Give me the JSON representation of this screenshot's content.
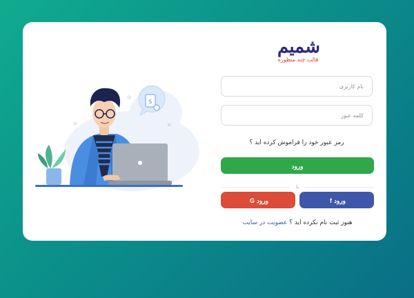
{
  "logo": {
    "mark": "شمیم",
    "tagline": "قالب چند منظوره"
  },
  "form": {
    "username_placeholder": "نام کاربری",
    "password_placeholder": "کلمه عبور",
    "forgot_text": "رمز عبور خود را فراموش کرده اید ؟",
    "login_label": "ورود",
    "or_text": "یا",
    "facebook_login_label": "ورود",
    "google_login_label": "ورود",
    "signup_prompt": "هنوز ثبت نام نکرده اید ؟",
    "signup_link": "عضویت در سایت"
  },
  "colors": {
    "login": "#2fa84a",
    "facebook": "#3f57a8",
    "google": "#dd4b39",
    "brand": "#2c2a7f",
    "link": "#3a5fa8"
  },
  "icons": {
    "facebook": "facebook-icon",
    "google": "google-icon"
  }
}
